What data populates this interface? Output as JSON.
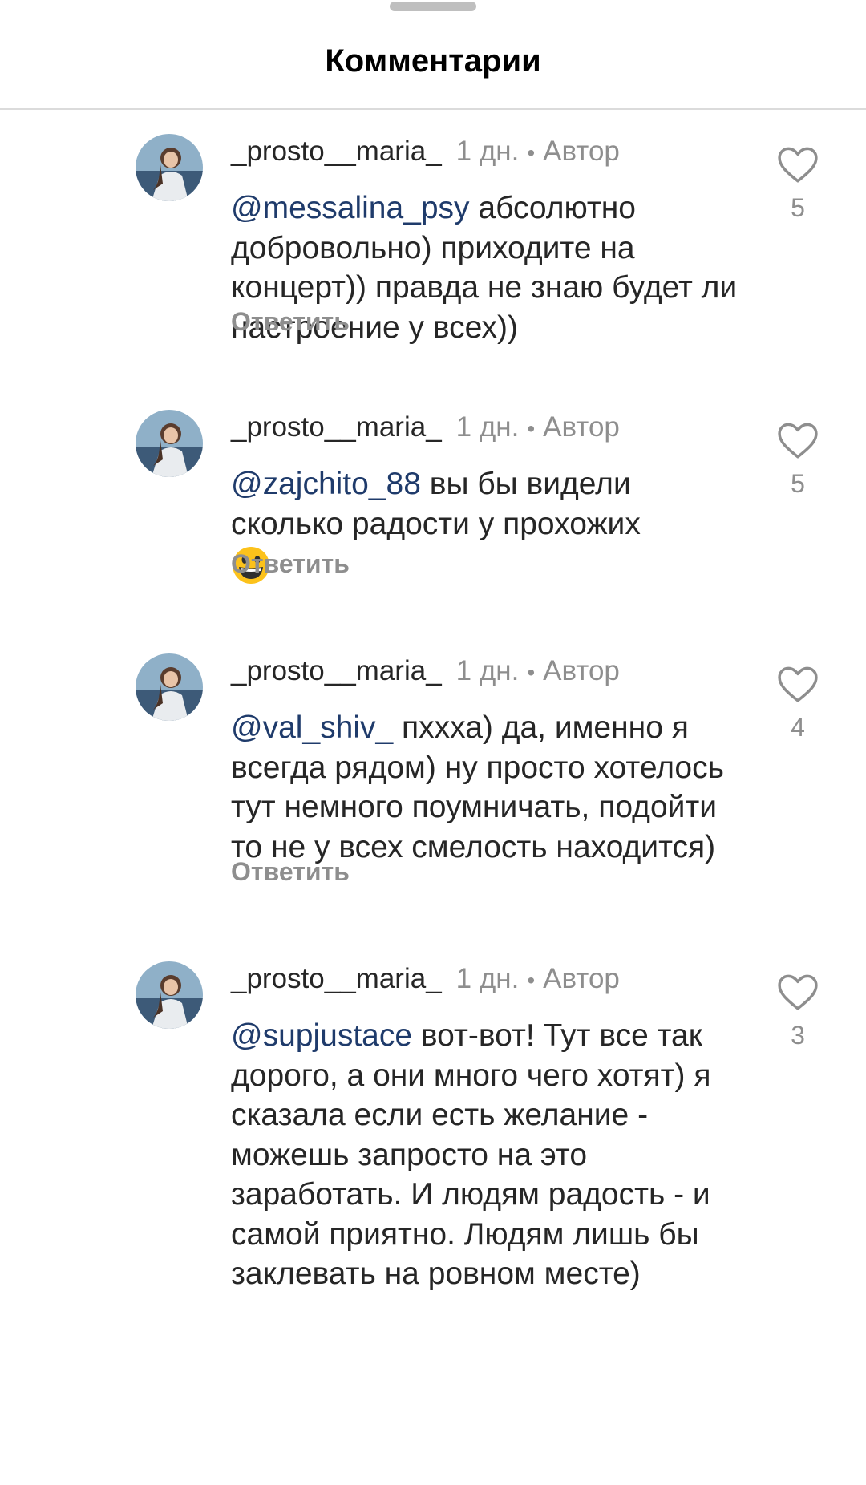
{
  "header": {
    "title": "Комментарии"
  },
  "comments": [
    {
      "username": "_prosto__maria_",
      "time": "1 дн.",
      "dot": "•",
      "badge": "Автор",
      "mention": "@messalina_psy",
      "text": " абсолютно добровольно) приходите на концерт)) правда не знаю будет ли настроение у всех))",
      "likes": "5",
      "reply": "Ответить"
    },
    {
      "username": "_prosto__maria_",
      "time": "1 дн.",
      "dot": "•",
      "badge": "Автор",
      "mention": "@zajchito_88",
      "text": " вы бы видели сколько радости у прохожих",
      "emoji": "grinning-face-emoji",
      "likes": "5",
      "reply": "Ответить"
    },
    {
      "username": "_prosto__maria_",
      "time": "1 дн.",
      "dot": "•",
      "badge": "Автор",
      "mention": "@val_shiv_",
      "text": " пхxха) да, именно я всегда рядом) ну просто хотелось тут немного поумничать, подойти то не у всех смелость находится)",
      "likes": "4",
      "reply": "Ответить"
    },
    {
      "username": "_prosto__maria_",
      "time": "1 дн.",
      "dot": "•",
      "badge": "Автор",
      "mention": "@supjustace",
      "text": " вот-вот! Тут все так дорого, а они много чего хотят) я сказала если есть желание - можешь запросто на это заработать. И людям радость - и самой приятно. Людям лишь бы заклевать на ровном месте)",
      "likes": "3"
    }
  ],
  "icons": {
    "like": "heart-outline-icon",
    "avatar": "profile-photo"
  },
  "colors": {
    "mention": "#1f3b6b",
    "secondary": "#8e8e8e",
    "text": "#262626"
  }
}
